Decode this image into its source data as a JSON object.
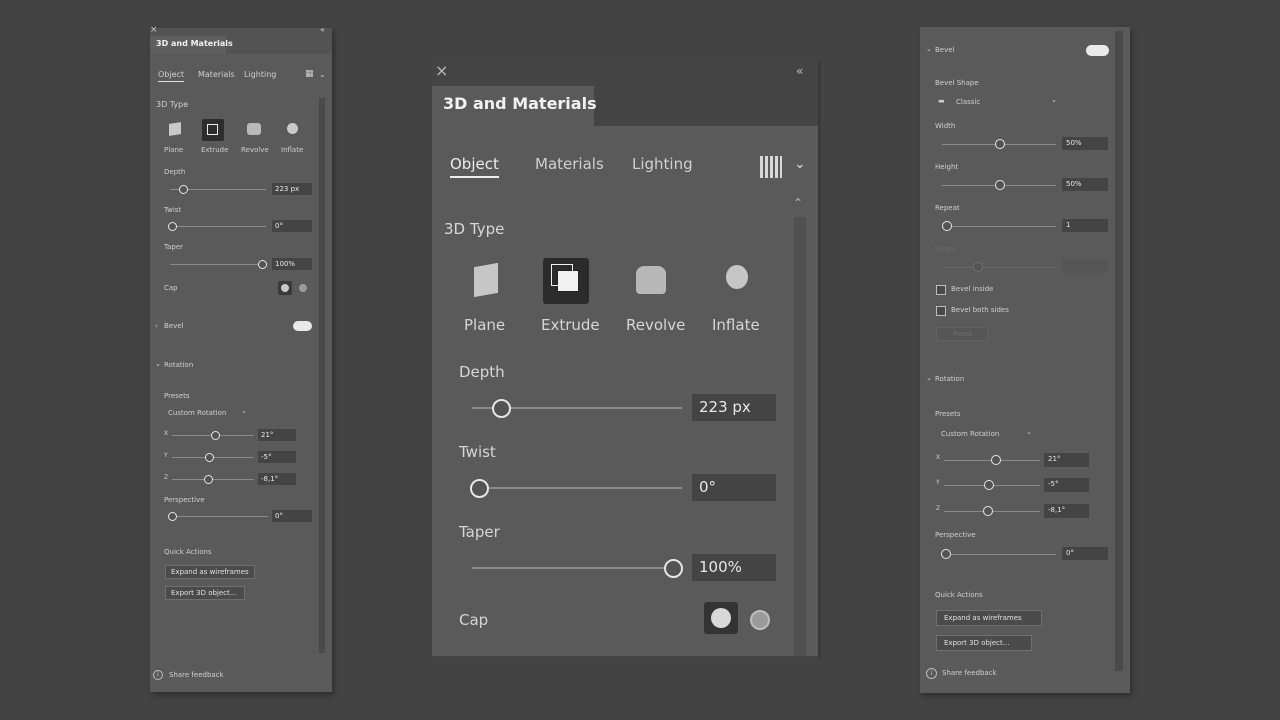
{
  "panel_title": "3D and Materials",
  "tabs": [
    "Object",
    "Materials",
    "Lighting"
  ],
  "section_3d_type": "3D Type",
  "types": [
    "Plane",
    "Extrude",
    "Revolve",
    "Inflate"
  ],
  "depth": {
    "label": "Depth",
    "value": "223 px"
  },
  "twist": {
    "label": "Twist",
    "value": "0°"
  },
  "taper": {
    "label": "Taper",
    "value": "100%"
  },
  "cap_label": "Cap",
  "bevel_label": "Bevel",
  "rotation": {
    "label": "Rotation",
    "presets_label": "Presets",
    "preset_value": "Custom Rotation",
    "x_label": "X",
    "x_value": "21°",
    "y_label": "Y",
    "y_value": "-5°",
    "z_label": "Z",
    "z_value": "-8,1°",
    "perspective_label": "Perspective",
    "perspective_value": "0°"
  },
  "quick_actions": {
    "label": "Quick Actions",
    "expand": "Expand as wireframes",
    "export": "Export 3D object..."
  },
  "feedback": "Share feedback",
  "bevel_panel": {
    "shape_label": "Bevel Shape",
    "shape_value": "Classic",
    "width_label": "Width",
    "width_value": "50%",
    "height_label": "Height",
    "height_value": "50%",
    "repeat_label": "Repeat",
    "repeat_value": "1",
    "space_label": "Space",
    "inside_label": "Bevel inside",
    "both_label": "Bevel both sides",
    "reset_label": "Reset"
  },
  "colors": {
    "background": "#434344",
    "panel": "#535353",
    "field": "#444444",
    "text": "#d6d6d6"
  }
}
